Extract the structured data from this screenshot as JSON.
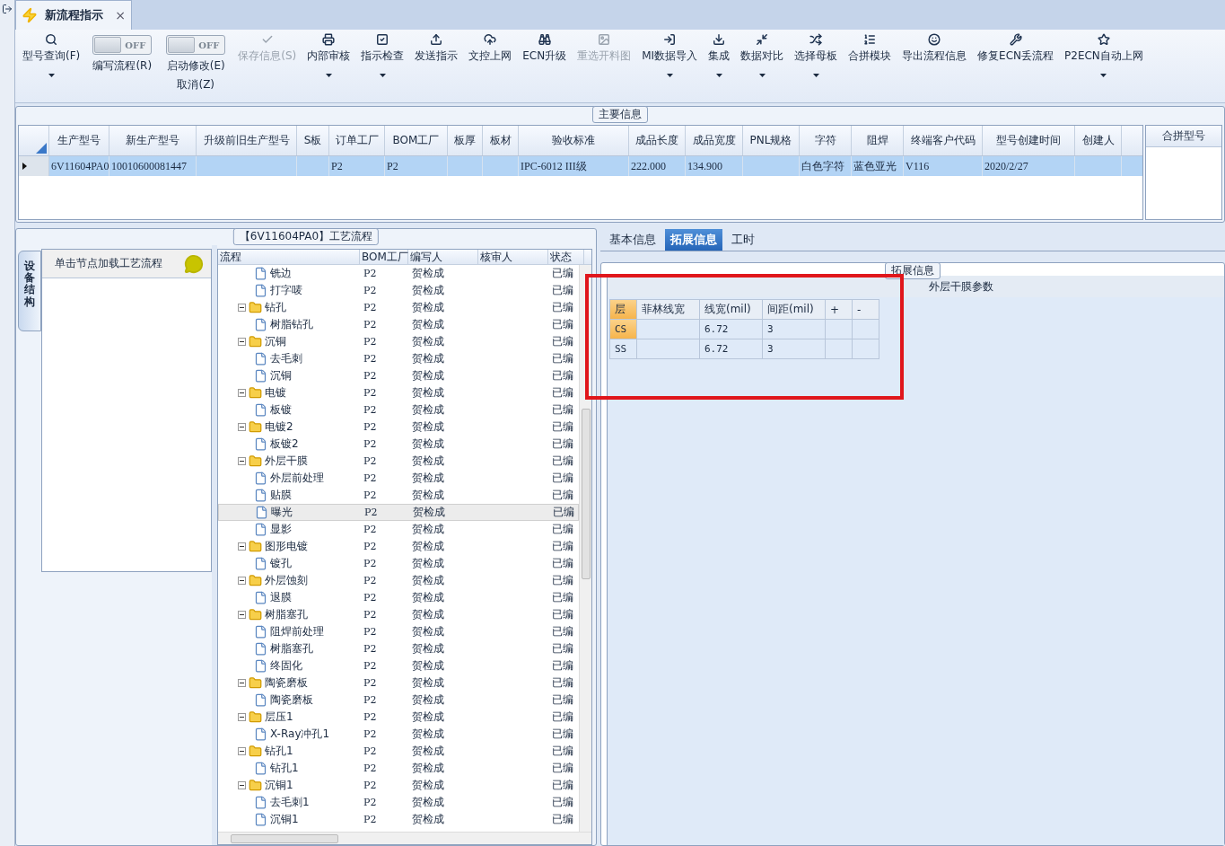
{
  "doc_tab": {
    "title": "新流程指示",
    "close": "×"
  },
  "toolbar": [
    {
      "kind": "button",
      "label": "型号查询(F)",
      "dropdown": true,
      "disabled": false
    },
    {
      "kind": "toggle",
      "label": "编写流程(R)",
      "on": false,
      "state_text": "OFF"
    },
    {
      "kind": "toggle",
      "label": "启动修改(E)",
      "label2": "取消(Z)",
      "on": false,
      "state_text": "OFF"
    },
    {
      "kind": "button",
      "label": "保存信息(S)",
      "dropdown": false,
      "disabled": true
    },
    {
      "kind": "button",
      "label": "内部审核",
      "dropdown": true,
      "disabled": false
    },
    {
      "kind": "button",
      "label": "指示检查",
      "dropdown": true,
      "disabled": false
    },
    {
      "kind": "button",
      "label": "发送指示",
      "dropdown": false,
      "disabled": false
    },
    {
      "kind": "button",
      "label": "文控上网",
      "dropdown": false,
      "disabled": false
    },
    {
      "kind": "button",
      "label": "ECN升级",
      "dropdown": false,
      "disabled": false
    },
    {
      "kind": "button",
      "label": "重选开料图",
      "dropdown": false,
      "disabled": true
    },
    {
      "kind": "button",
      "label": "MI数据导入",
      "dropdown": true,
      "disabled": false
    },
    {
      "kind": "button",
      "label": "集成",
      "dropdown": true,
      "disabled": false
    },
    {
      "kind": "button",
      "label": "数据对比",
      "dropdown": true,
      "disabled": false
    },
    {
      "kind": "button",
      "label": "选择母板",
      "dropdown": true,
      "disabled": false
    },
    {
      "kind": "button",
      "label": "合拼模块",
      "dropdown": false,
      "disabled": false
    },
    {
      "kind": "button",
      "label": "导出流程信息",
      "dropdown": false,
      "disabled": false
    },
    {
      "kind": "button",
      "label": "修复ECN丢流程",
      "dropdown": false,
      "disabled": false
    },
    {
      "kind": "button",
      "label": "P2ECN自动上网",
      "dropdown": true,
      "disabled": false
    }
  ],
  "main_info": {
    "title": "主要信息",
    "columns": [
      "生产型号",
      "新生产型号",
      "升级前旧生产型号",
      "S板",
      "订单工厂",
      "BOM工厂",
      "板厚",
      "板材",
      "验收标准",
      "成品长度",
      "成品宽度",
      "PNL规格",
      "字符",
      "阻焊",
      "终端客户代码",
      "型号创建时间",
      "创建人"
    ],
    "rows": [
      {
        "selected": true,
        "cells": [
          "6V11604PA0",
          "10010600081447",
          "",
          "",
          "P2",
          "P2",
          "",
          "",
          "IPC-6012 III级",
          "222.000",
          "134.900",
          "",
          "白色字符",
          "蓝色亚光",
          "V116",
          "2020/2/27",
          ""
        ]
      }
    ],
    "side_column": "合拼型号"
  },
  "process": {
    "title": "【6V11604PA0】工艺流程",
    "side_tab": "设备结构",
    "hint": "单击节点加载工艺流程",
    "columns": [
      "流程",
      "BOM工厂",
      "编写人",
      "核审人",
      "状态"
    ],
    "rows": [
      {
        "children": [
          {
            "name": "铣边",
            "kind": "file",
            "bom": "P2",
            "writer": "贺检成",
            "status": "已编",
            "selected": false
          },
          {
            "name": "打字唛",
            "kind": "file",
            "bom": "P2",
            "writer": "贺检成",
            "status": "已编",
            "selected": false
          }
        ]
      },
      {
        "name": "钻孔",
        "kind": "folder",
        "expanded": true,
        "bom": "P2",
        "writer": "贺检成",
        "status": "已编",
        "selected": false,
        "children": [
          {
            "name": "树脂钻孔",
            "kind": "file",
            "bom": "P2",
            "writer": "贺检成",
            "status": "已编",
            "selected": false
          }
        ]
      },
      {
        "name": "沉铜",
        "kind": "folder",
        "expanded": true,
        "bom": "P2",
        "writer": "贺检成",
        "status": "已编",
        "selected": false,
        "children": [
          {
            "name": "去毛刺",
            "kind": "file",
            "bom": "P2",
            "writer": "贺检成",
            "status": "已编",
            "selected": false
          },
          {
            "name": "沉铜",
            "kind": "file",
            "bom": "P2",
            "writer": "贺检成",
            "status": "已编",
            "selected": false
          }
        ]
      },
      {
        "name": "电镀",
        "kind": "folder",
        "expanded": true,
        "bom": "P2",
        "writer": "贺检成",
        "status": "已编",
        "selected": false,
        "children": [
          {
            "name": "板镀",
            "kind": "file",
            "bom": "P2",
            "writer": "贺检成",
            "status": "已编",
            "selected": false
          }
        ]
      },
      {
        "name": "电镀2",
        "kind": "folder",
        "expanded": true,
        "bom": "P2",
        "writer": "贺检成",
        "status": "已编",
        "selected": false,
        "children": [
          {
            "name": "板镀2",
            "kind": "file",
            "bom": "P2",
            "writer": "贺检成",
            "status": "已编",
            "selected": false
          }
        ]
      },
      {
        "name": "外层干膜",
        "kind": "folder",
        "expanded": true,
        "bom": "P2",
        "writer": "贺检成",
        "status": "已编",
        "selected": false,
        "children": [
          {
            "name": "外层前处理",
            "kind": "file",
            "bom": "P2",
            "writer": "贺检成",
            "status": "已编",
            "selected": false
          },
          {
            "name": "贴膜",
            "kind": "file",
            "bom": "P2",
            "writer": "贺检成",
            "status": "已编",
            "selected": false
          },
          {
            "name": "曝光",
            "kind": "file",
            "bom": "P2",
            "writer": "贺检成",
            "status": "已编",
            "selected": true
          },
          {
            "name": "显影",
            "kind": "file",
            "bom": "P2",
            "writer": "贺检成",
            "status": "已编",
            "selected": false
          }
        ]
      },
      {
        "name": "图形电镀",
        "kind": "folder",
        "expanded": true,
        "bom": "P2",
        "writer": "贺检成",
        "status": "已编",
        "selected": false,
        "children": [
          {
            "name": "镀孔",
            "kind": "file",
            "bom": "P2",
            "writer": "贺检成",
            "status": "已编",
            "selected": false
          }
        ]
      },
      {
        "name": "外层蚀刻",
        "kind": "folder",
        "expanded": true,
        "bom": "P2",
        "writer": "贺检成",
        "status": "已编",
        "selected": false,
        "children": [
          {
            "name": "退膜",
            "kind": "file",
            "bom": "P2",
            "writer": "贺检成",
            "status": "已编",
            "selected": false
          }
        ]
      },
      {
        "name": "树脂塞孔",
        "kind": "folder",
        "expanded": true,
        "bom": "P2",
        "writer": "贺检成",
        "status": "已编",
        "selected": false,
        "children": [
          {
            "name": "阻焊前处理",
            "kind": "file",
            "bom": "P2",
            "writer": "贺检成",
            "status": "已编",
            "selected": false
          },
          {
            "name": "树脂塞孔",
            "kind": "file",
            "bom": "P2",
            "writer": "贺检成",
            "status": "已编",
            "selected": false
          },
          {
            "name": "终固化",
            "kind": "file",
            "bom": "P2",
            "writer": "贺检成",
            "status": "已编",
            "selected": false
          }
        ]
      },
      {
        "name": "陶瓷磨板",
        "kind": "folder",
        "expanded": true,
        "bom": "P2",
        "writer": "贺检成",
        "status": "已编",
        "selected": false,
        "children": [
          {
            "name": "陶瓷磨板",
            "kind": "file",
            "bom": "P2",
            "writer": "贺检成",
            "status": "已编",
            "selected": false
          }
        ]
      },
      {
        "name": "层压1",
        "kind": "folder",
        "expanded": true,
        "bom": "P2",
        "writer": "贺检成",
        "status": "已编",
        "selected": false,
        "children": [
          {
            "name": "X-Ray冲孔1",
            "kind": "file",
            "bom": "P2",
            "writer": "贺检成",
            "status": "已编",
            "selected": false
          }
        ]
      },
      {
        "name": "钻孔1",
        "kind": "folder",
        "expanded": true,
        "bom": "P2",
        "writer": "贺检成",
        "status": "已编",
        "selected": false,
        "children": [
          {
            "name": "钻孔1",
            "kind": "file",
            "bom": "P2",
            "writer": "贺检成",
            "status": "已编",
            "selected": false
          }
        ]
      },
      {
        "name": "沉铜1",
        "kind": "folder",
        "expanded": true,
        "bom": "P2",
        "writer": "贺检成",
        "status": "已编",
        "selected": false,
        "children": [
          {
            "name": "去毛刺1",
            "kind": "file",
            "bom": "P2",
            "writer": "贺检成",
            "status": "已编",
            "selected": false
          },
          {
            "name": "沉铜1",
            "kind": "file",
            "bom": "P2",
            "writer": "贺检成",
            "status": "已编",
            "selected": false
          }
        ]
      }
    ]
  },
  "detail_tabs": [
    {
      "label": "基本信息",
      "selected": false
    },
    {
      "label": "拓展信息",
      "selected": true
    },
    {
      "label": "工时",
      "selected": false
    }
  ],
  "extended": {
    "title": "拓展信息",
    "panel_title": "外层干膜参数",
    "highlighted": true,
    "columns": [
      "层",
      "菲林线宽",
      "线宽(mil)",
      "间距(mil)",
      "+",
      "-"
    ],
    "rows": [
      {
        "selected": true,
        "cells": [
          "CS",
          "",
          "6.72",
          "3",
          "",
          ""
        ]
      },
      {
        "selected": false,
        "cells": [
          "SS",
          "",
          "6.72",
          "3",
          "",
          ""
        ]
      }
    ]
  }
}
